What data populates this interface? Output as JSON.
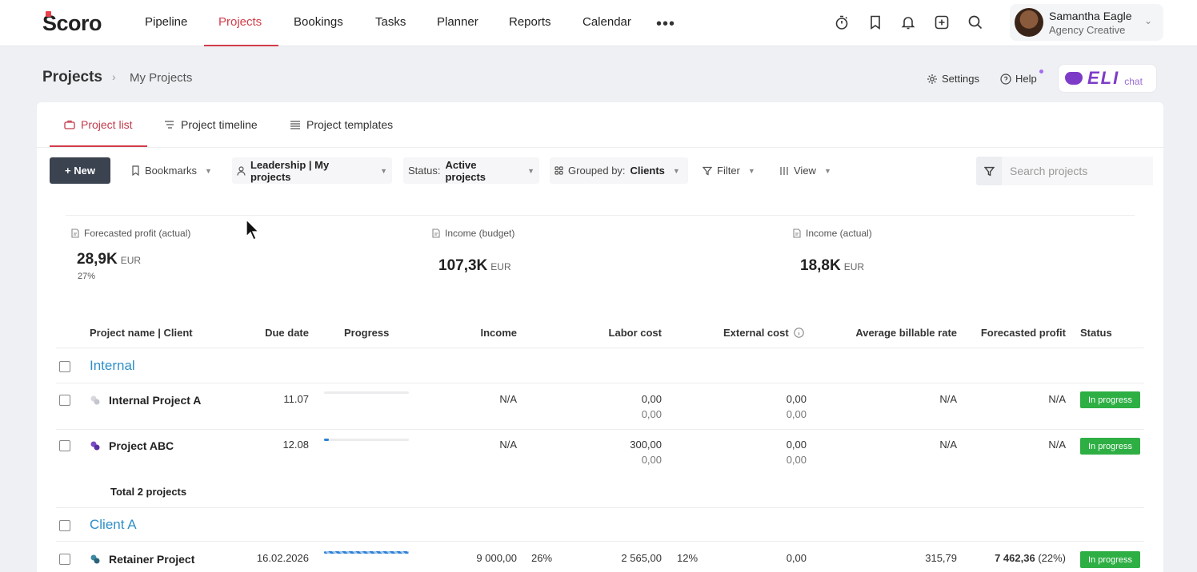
{
  "app": {
    "logo": "Scoro",
    "nav": [
      "Pipeline",
      "Projects",
      "Bookings",
      "Tasks",
      "Planner",
      "Reports",
      "Calendar"
    ],
    "nav_active": "Projects",
    "more": "•••",
    "user": {
      "name": "Samantha Eagle",
      "org": "Agency Creative"
    },
    "icons": [
      "stopwatch-icon",
      "bookmark-icon",
      "bell-icon",
      "add-square-icon",
      "search-icon"
    ]
  },
  "breadcrumb": {
    "title": "Projects",
    "sub": "My Projects"
  },
  "header_links": {
    "settings": "Settings",
    "help": "Help",
    "eli": "ELI",
    "eli_chat": "chat"
  },
  "tabs": [
    "Project list",
    "Project timeline",
    "Project templates"
  ],
  "toolbar": {
    "new": "+ New",
    "bookmarks": "Bookmarks",
    "view_name": "Leadership | My projects",
    "status_label": "Status:",
    "status_value": "Active projects",
    "grouped_label": "Grouped by:",
    "grouped_value": "Clients",
    "filter": "Filter",
    "view": "View",
    "search_placeholder": "Search projects"
  },
  "stats": [
    {
      "label": "Forecasted profit (actual)",
      "value": "28,9K",
      "unit": "EUR",
      "sub": "27%"
    },
    {
      "label": "Income (budget)",
      "value": "107,3K",
      "unit": "EUR"
    },
    {
      "label": "Income (actual)",
      "value": "18,8K",
      "unit": "EUR"
    }
  ],
  "table": {
    "columns": [
      "Project name | Client",
      "Due date",
      "Progress",
      "Income",
      "Labor cost",
      "External cost",
      "Average billable rate",
      "Forecasted profit",
      "Status"
    ],
    "groups": [
      {
        "name": "Internal",
        "rows": [
          {
            "name": "Internal Project A",
            "icon": "project-gray-icon",
            "due": "11.07",
            "progress": 0,
            "income": "N/A",
            "labor": "0,00",
            "labor_sub": "0,00",
            "external": "0,00",
            "external_sub": "0,00",
            "rate": "N/A",
            "profit": "N/A",
            "status": "In progress"
          },
          {
            "name": "Project ABC",
            "icon": "project-purple-icon",
            "due": "12.08",
            "progress": 0.06,
            "income": "N/A",
            "labor": "300,00",
            "labor_sub": "0,00",
            "external": "0,00",
            "external_sub": "0,00",
            "rate": "N/A",
            "profit": "N/A",
            "status": "In progress"
          }
        ],
        "total": "Total 2 projects"
      },
      {
        "name": "Client A",
        "rows": [
          {
            "name": "Retainer Project",
            "icon": "project-teal-icon",
            "due": "16.02.2026",
            "progress": 1.0,
            "income": "9 000,00",
            "income_pct": "26%",
            "labor": "2 565,00",
            "labor_pct": "12%",
            "external": "0,00",
            "rate": "315,79",
            "profit": "7 462,36",
            "profit_pct": "(22%)",
            "status": "In progress"
          }
        ]
      }
    ]
  },
  "colors": {
    "accent": "#d23c4a",
    "group_title": "#2e8fc7",
    "status_green": "#2eaf44",
    "progress_blue": "#2e7fd2",
    "eli_purple": "#7d3cc8"
  }
}
